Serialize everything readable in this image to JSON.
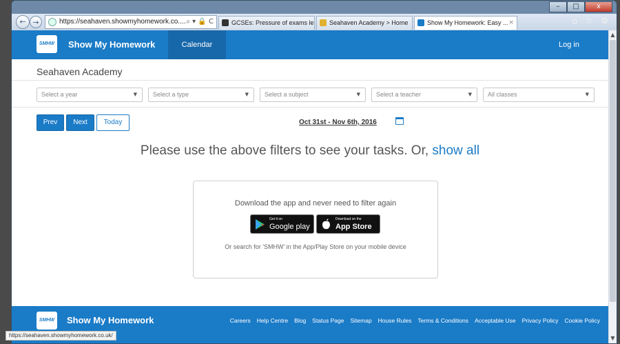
{
  "browser": {
    "address": "https://seahaven.showmyhomework.co....",
    "address_tools": "⌕ ▾ 🔒 C",
    "tabs": [
      {
        "label": "GCSEs: Pressure of exams leave..."
      },
      {
        "label": "Seahaven Academy > Home"
      },
      {
        "label": "Show My Homework: Easy ..."
      }
    ],
    "window_controls": {
      "minimize": "–",
      "maximize": "□",
      "close": "x"
    },
    "toolbar_icons": "⌂ ☆ ⚙",
    "status_url": "https://seahaven.showmyhomework.co.uk/"
  },
  "header": {
    "logo": "SMHW",
    "brand": "Show My Homework",
    "nav_calendar": "Calendar",
    "login": "Log in"
  },
  "school_name": "Seahaven Academy",
  "filters": [
    {
      "placeholder": "Select a year"
    },
    {
      "placeholder": "Select a type"
    },
    {
      "placeholder": "Select a subject"
    },
    {
      "placeholder": "Select a teacher"
    },
    {
      "placeholder": "All classes"
    }
  ],
  "controls": {
    "prev": "Prev",
    "next": "Next",
    "today": "Today",
    "date_range": "Oct 31st - Nov 6th, 2016"
  },
  "prompt": {
    "text": "Please use the above filters to see your tasks. Or, ",
    "link": "show all"
  },
  "app_box": {
    "title": "Download the app and never need to filter again",
    "google_small": "Get it on",
    "google_big": "Google play",
    "apple_small": "Download on the",
    "apple_big": "App Store",
    "note": "Or search for 'SMHW' in the App/Play Store on your mobile device"
  },
  "footer": {
    "logo": "SMHW",
    "brand": "Show My Homework",
    "links": [
      "Careers",
      "Help Centre",
      "Blog",
      "Status Page",
      "Sitemap",
      "House Rules",
      "Terms & Conditions",
      "Acceptable Use",
      "Privacy Policy",
      "Cookie Policy"
    ]
  },
  "colors": {
    "brand_blue": "#1a7bc7"
  }
}
